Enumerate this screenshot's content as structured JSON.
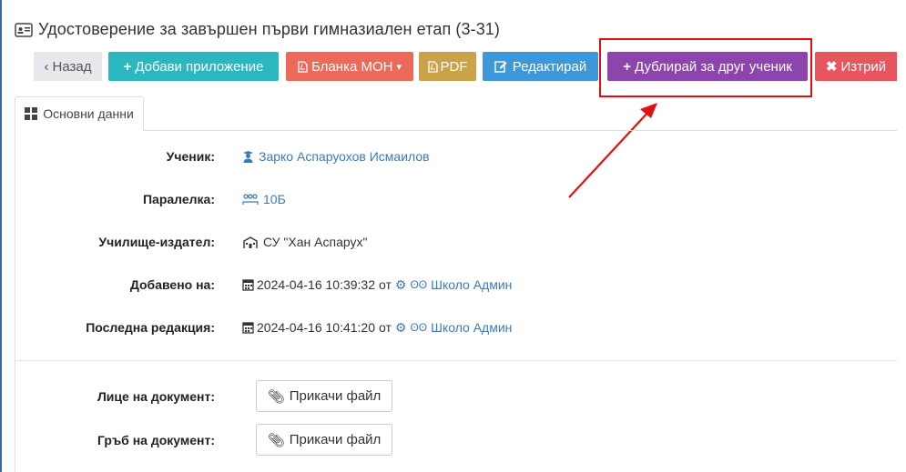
{
  "title": "Удостоверение за завършен първи гимназиален етап (3-31)",
  "toolbar": {
    "back": "Назад",
    "add_attachment": "Добави приложение",
    "blank_mon": "Бланка МОН",
    "pdf": "PDF",
    "edit": "Редактирай",
    "duplicate": "Дублирай за друг ученик",
    "delete": "Изтрий"
  },
  "tab": {
    "label": "Основни данни"
  },
  "fields": {
    "student_label": "Ученик:",
    "student_value": "Зарко Аспаруохов Исмаилов",
    "class_label": "Паралелка:",
    "class_value": "10Б",
    "school_label": "Училище-издател:",
    "school_value": "СУ \"Хан Аспарух\"",
    "added_label": "Добавено на:",
    "added_date": "2024-04-16 10:39:32",
    "added_by_prefix": "от",
    "added_by": "Школо Админ",
    "edited_label": "Последна редакция:",
    "edited_date": "2024-04-16 10:41:20",
    "edited_by_prefix": "от",
    "edited_by": "Школо Админ"
  },
  "attachments": {
    "front_label": "Лице на документ:",
    "back_label": "Гръб на документ:",
    "attach_button": "Прикачи файл"
  },
  "colors": {
    "add": "#2bb7c0",
    "mon": "#ec6a5a",
    "pdf": "#c9a24a",
    "edit": "#3d97d8",
    "duplicate": "#8d44ad",
    "delete": "#e9555f",
    "highlight": "#e01010",
    "link": "#3d7ab8"
  }
}
